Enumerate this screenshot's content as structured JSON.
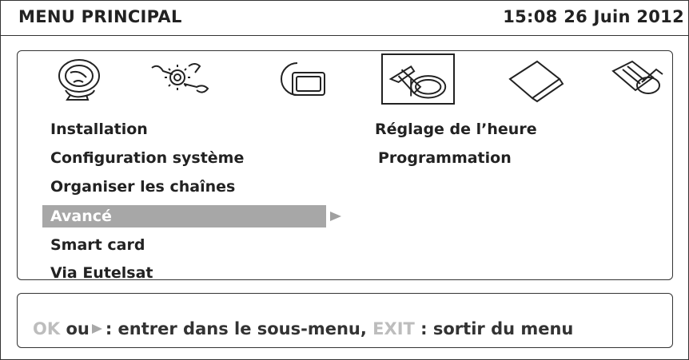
{
  "header": {
    "title": "MENU PRINCIPAL",
    "datetime": "15:08 26 Juin 2012"
  },
  "icons": [
    {
      "name": "satellite-dish-icon",
      "selected": false
    },
    {
      "name": "tools-gear-icon",
      "selected": false
    },
    {
      "name": "tv-screen-icon",
      "selected": false
    },
    {
      "name": "clock-time-icon",
      "selected": true
    },
    {
      "name": "book-icon",
      "selected": false
    },
    {
      "name": "game-icon",
      "selected": false
    }
  ],
  "left_menu": {
    "items": [
      {
        "label": "Installation"
      },
      {
        "label": "Configuration système"
      },
      {
        "label": "Organiser les chaînes"
      },
      {
        "label": "Avancé",
        "highlighted": true
      },
      {
        "label": "Smart card"
      },
      {
        "label": "Via Eutelsat"
      }
    ]
  },
  "right_menu": {
    "items": [
      {
        "label": "Réglage de l’heure"
      },
      {
        "label": "Programmation"
      }
    ]
  },
  "help": {
    "ok_key": "OK",
    "ou": "ou",
    "enter_text": ": entrer dans le sous-menu,",
    "exit_key": "EXIT",
    "exit_text": ": sortir du menu"
  },
  "colors": {
    "highlight": "#a7a7a7",
    "muted_key": "#bdbdbd",
    "text": "#222222"
  }
}
